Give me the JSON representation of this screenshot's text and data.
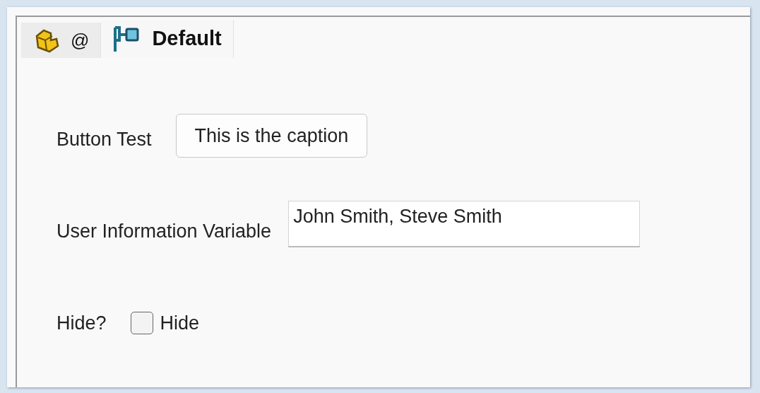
{
  "tabs": [
    {
      "label": "@",
      "kind": "part",
      "selected": false
    },
    {
      "label": "Default",
      "kind": "configuration",
      "selected": true
    }
  ],
  "rows": [
    {
      "kind": "button",
      "label": "Button Test",
      "caption": "This is the caption"
    },
    {
      "kind": "text",
      "label": "User Information Variable",
      "value": "John Smith, Steve Smith"
    },
    {
      "kind": "checkbox",
      "label": "Hide?",
      "caption": "Hide",
      "checked": false
    }
  ]
}
